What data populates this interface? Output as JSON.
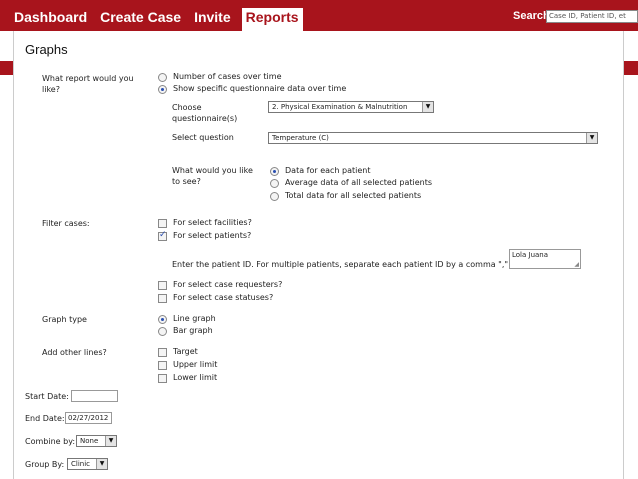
{
  "nav": {
    "items": [
      {
        "label": "Dashboard"
      },
      {
        "label": "Create Case"
      },
      {
        "label": "Invite"
      },
      {
        "label": "Reports",
        "active": true
      }
    ],
    "search_label": "Search:",
    "search_placeholder": "Case ID, Patient ID, et"
  },
  "page": {
    "title": "Graphs"
  },
  "report": {
    "label_line1": "What report would you",
    "label_line2": "like?",
    "options": [
      "Number of cases over time",
      "Show specific questionnaire data over time"
    ],
    "selected": 1
  },
  "questionnaire": {
    "label_line1": "Choose",
    "label_line2": "questionnaire(s)",
    "value": "2. Physical Examination & Malnutrition"
  },
  "question": {
    "label": "Select question",
    "value": "Temperature (C)"
  },
  "see": {
    "label_line1": "What would you like",
    "label_line2": "to see?",
    "options": [
      "Data for each patient",
      "Average data of all selected patients",
      "Total data for all selected patients"
    ],
    "selected": 0
  },
  "filter": {
    "label": "Filter cases:",
    "facilities": "For select facilities?",
    "patients": "For select patients?",
    "patient_id_prompt": "Enter the patient ID. For multiple patients, separate each patient ID by a comma \",\"",
    "patient_id_value": "Lola Juana",
    "requesters": "For select case requesters?",
    "statuses": "For select case statuses?"
  },
  "graph_type": {
    "label": "Graph type",
    "options": [
      "Line graph",
      "Bar graph"
    ],
    "selected": 0
  },
  "other_lines": {
    "label": "Add other lines?",
    "options": [
      "Target",
      "Upper limit",
      "Lower limit"
    ]
  },
  "dates": {
    "start_label": "Start Date:",
    "start_value": "",
    "end_label": "End Date:",
    "end_value": "02/27/2012"
  },
  "combine": {
    "label": "Combine by:",
    "value": "None"
  },
  "group": {
    "label": "Group By:",
    "value": "Clinic"
  }
}
